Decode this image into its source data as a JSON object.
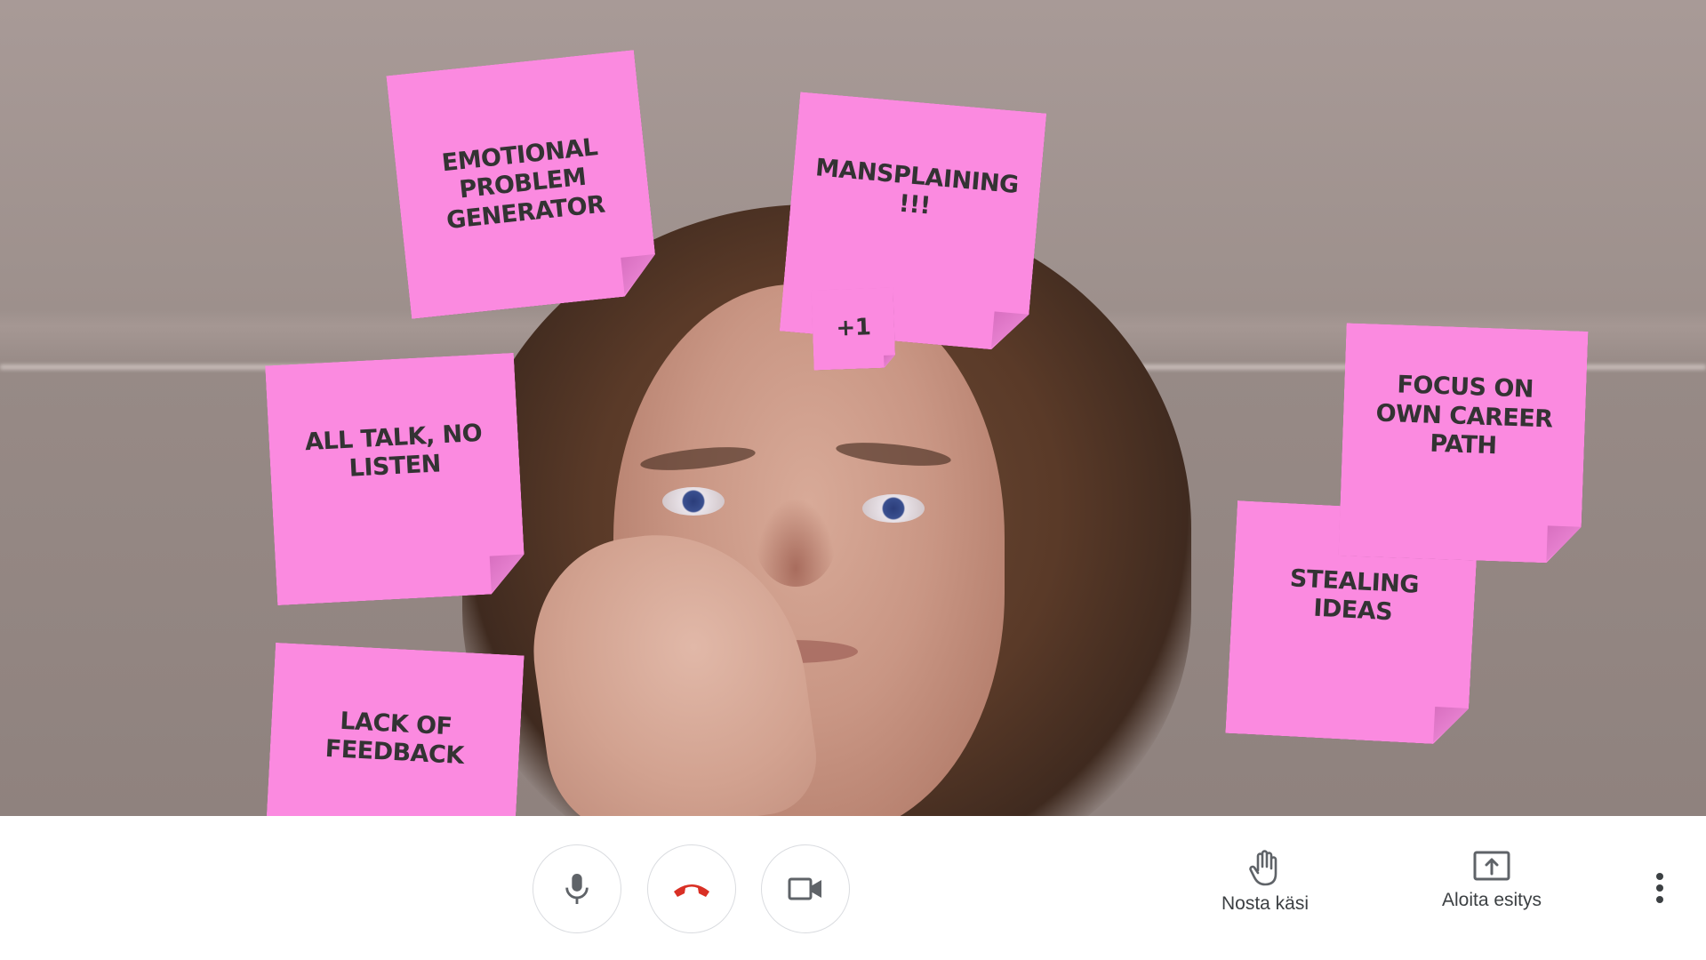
{
  "colors": {
    "note_pink": "#fb8ae0",
    "note_text": "#333333",
    "end_call_red": "#d93025",
    "icon_gray": "#5f6368"
  },
  "notes": [
    {
      "text": "EMOTIONAL PROBLEM GENERATOR"
    },
    {
      "text": "MANSPLAINING !!!"
    },
    {
      "text": "+1"
    },
    {
      "text": "ALL TALK, NO LISTEN"
    },
    {
      "text": "FOCUS ON OWN CAREER PATH"
    },
    {
      "text": "STEALING IDEAS"
    },
    {
      "text": "LACK OF FEEDBACK"
    }
  ],
  "controls": {
    "mic_icon": "microphone-icon",
    "end_call_icon": "phone-hangup-icon",
    "camera_icon": "video-camera-icon",
    "raise_hand_label": "Nosta käsi",
    "raise_hand_icon": "hand-icon",
    "present_label": "Aloita esitys",
    "present_icon": "present-screen-icon",
    "more_icon": "more-vertical-icon"
  }
}
